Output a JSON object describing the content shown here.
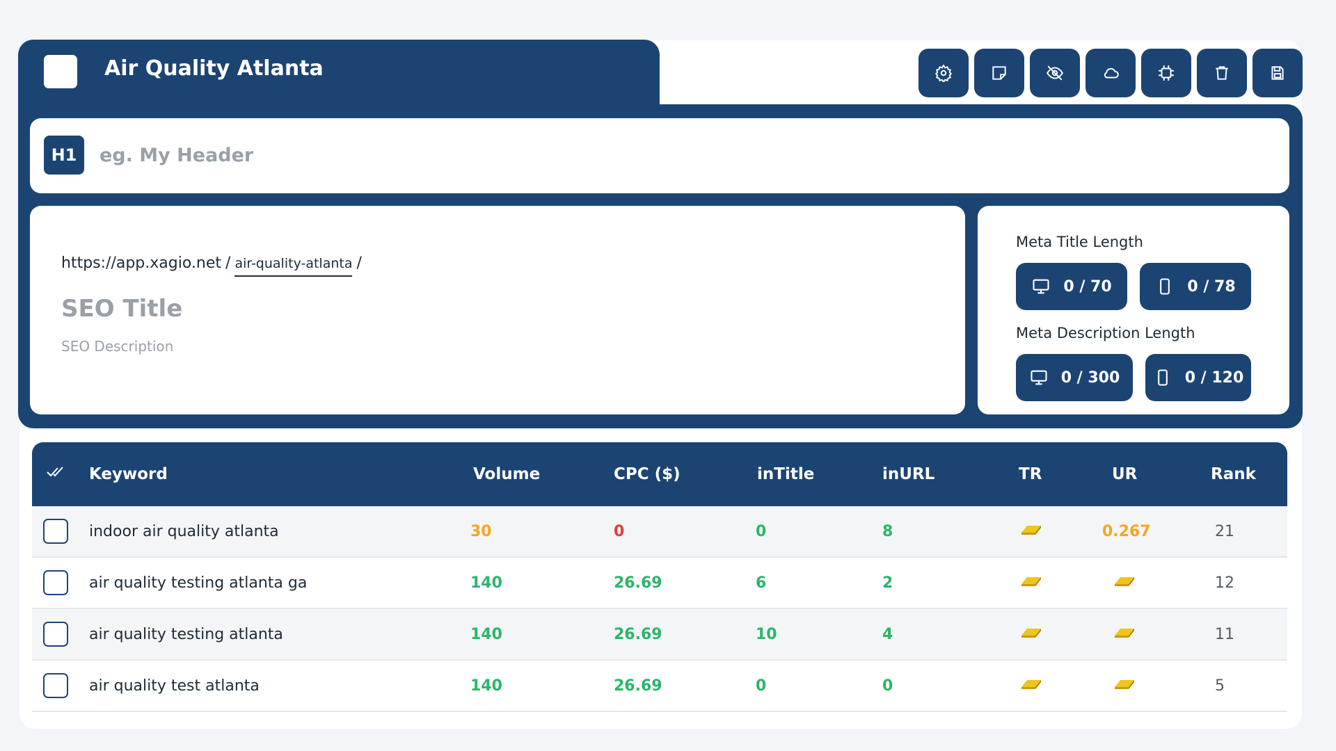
{
  "header": {
    "title": "Air Quality Atlanta"
  },
  "toolbar": {
    "buttons": [
      {
        "name": "settings-button",
        "icon": "gear-icon"
      },
      {
        "name": "notes-button",
        "icon": "note-icon"
      },
      {
        "name": "hide-button",
        "icon": "eye-off-icon"
      },
      {
        "name": "cloud-button",
        "icon": "cloud-icon"
      },
      {
        "name": "ai-button",
        "icon": "chip-icon"
      },
      {
        "name": "delete-button",
        "icon": "trash-icon"
      },
      {
        "name": "save-button",
        "icon": "save-icon"
      }
    ]
  },
  "h1": {
    "badge": "H1",
    "placeholder": "eg. My Header"
  },
  "seo": {
    "url_base": "https://app.xagio.net",
    "url_sep": "/",
    "slug": "air-quality-atlanta",
    "url_end": "/",
    "title_placeholder": "SEO Title",
    "description_placeholder": "SEO Description"
  },
  "meta": {
    "title_label": "Meta Title Length",
    "title_desktop": "0 / 70",
    "title_mobile": "0 / 78",
    "desc_label": "Meta Description Length",
    "desc_desktop": "0 / 300",
    "desc_mobile": "0 / 120"
  },
  "table": {
    "headers": {
      "keyword": "Keyword",
      "volume": "Volume",
      "cpc": "CPC ($)",
      "intitle": "inTitle",
      "inurl": "inURL",
      "tr": "TR",
      "ur": "UR",
      "rank": "Rank"
    },
    "rows": [
      {
        "keyword": "indoor air quality atlanta",
        "volume": "30",
        "cpc": "0",
        "intitle": "0",
        "inurl": "8",
        "tr": "gold-bar-icon",
        "ur": "0.267",
        "rank": "21"
      },
      {
        "keyword": "air quality testing atlanta ga",
        "volume": "140",
        "cpc": "26.69",
        "intitle": "6",
        "inurl": "2",
        "tr": "gold-bar-icon",
        "ur": "gold-bar-icon",
        "rank": "12"
      },
      {
        "keyword": "air quality testing atlanta",
        "volume": "140",
        "cpc": "26.69",
        "intitle": "10",
        "inurl": "4",
        "tr": "gold-bar-icon",
        "ur": "gold-bar-icon",
        "rank": "11"
      },
      {
        "keyword": "air quality test atlanta",
        "volume": "140",
        "cpc": "26.69",
        "intitle": "0",
        "inurl": "0",
        "tr": "gold-bar-icon",
        "ur": "gold-bar-icon",
        "rank": "5"
      }
    ]
  },
  "colors": {
    "primary": "#1c4473",
    "green": "#2db56a",
    "orange": "#f5a623",
    "red": "#e53b3b"
  }
}
